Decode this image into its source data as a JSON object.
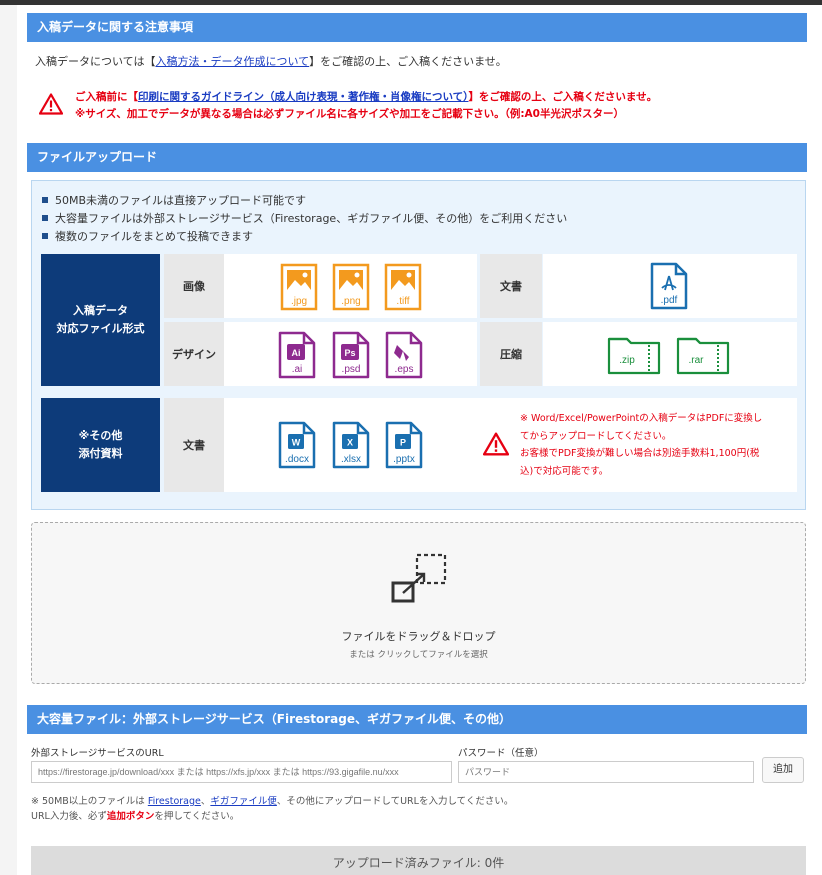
{
  "notice": {
    "heading": "入稿データに関する注意事項",
    "line_pre": "入稿データについては【",
    "line_link": "入稿方法・データ作成について",
    "line_post": "】をご確認の上、ご入稿くださいませ。",
    "warn1_pre": "ご入稿前に【",
    "warn1_link": "印刷に関するガイドライン（成人向け表現・著作権・肖像権について）",
    "warn1_post": "】をご確認の上、ご入稿くださいませ。",
    "warn2": "※サイズ、加工でデータが異なる場合は必ずファイル名に各サイズや加工をご記載下さい。（例:A0半光沢ポスター）"
  },
  "upload": {
    "heading": "ファイルアップロード",
    "bullets": [
      "50MB未満のファイルは直接アップロード可能です",
      "大容量ファイルは外部ストレージサービス（Firestorage、ギガファイル便、その他）をご利用ください",
      "複数のファイルをまとめて投稿できます"
    ],
    "formats_label_1": "入稿データ",
    "formats_label_2": "対応ファイル形式",
    "row_image": "画像",
    "row_doc": "文書",
    "row_design": "デザイン",
    "row_archive": "圧縮",
    "other_label_1": "※その他",
    "other_label_2": "添付資料",
    "other_doc": "文書",
    "icons": {
      "jpg": ".jpg",
      "png": ".png",
      "tiff": ".tiff",
      "pdf": ".pdf",
      "ai": ".ai",
      "ai_badge": "Ai",
      "psd": ".psd",
      "psd_badge": "Ps",
      "eps": ".eps",
      "zip": ".zip",
      "rar": ".rar",
      "docx": ".docx",
      "docx_badge": "W",
      "xlsx": ".xlsx",
      "xlsx_badge": "X",
      "pptx": ".pptx",
      "pptx_badge": "P"
    },
    "office_note": [
      "※ Word/Excel/PowerPointの入稿データはPDFに変換し",
      "てからアップロードしてください。",
      "お客様でPDF変換が難しい場合は別途手数料1,100円(税",
      "込)で対応可能です。"
    ],
    "drop_title": "ファイルをドラッグ＆ドロップ",
    "drop_sub": "または クリックしてファイルを選択"
  },
  "external": {
    "heading": "大容量ファイル：外部ストレージサービス（Firestorage、ギガファイル便、その他）",
    "url_label": "外部ストレージサービスのURL",
    "url_placeholder": "https://firestorage.jp/download/xxx または https://xfs.jp/xxx または https://93.gigafile.nu/xxx",
    "pw_label": "パスワード（任意）",
    "pw_placeholder": "パスワード",
    "add_button": "追加",
    "note1_pre": "※ 50MB以上のファイルは ",
    "note1_link1": "Firestorage",
    "note1_sep": "、",
    "note1_link2": "ギガファイル便",
    "note1_post": "、その他にアップロードしてURLを入力してください。",
    "note2_pre": "URL入力後、必ず",
    "note2_strong": "追加ボタン",
    "note2_post": "を押してください。"
  },
  "uploaded_files": "アップロード済みファイル: 0件",
  "colors": {
    "header_blue": "#4a90e2",
    "navy": "#0d3b7a",
    "image_orange": "#f39a1e",
    "design_purple": "#8e2a8f",
    "archive_green": "#1a8f3c",
    "office_blue": "#1a6fb0",
    "pdf_blue": "#1a6fb0",
    "warning_red": "#e60012"
  }
}
